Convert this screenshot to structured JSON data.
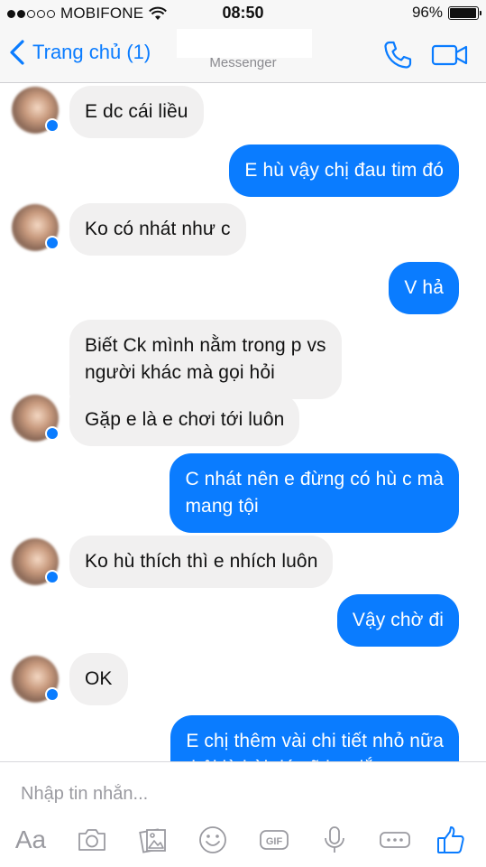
{
  "status_bar": {
    "carrier": "MOBIFONE",
    "time": "08:50",
    "battery": "96%",
    "battery_level": 0.96
  },
  "nav": {
    "back_label": "Trang chủ (1)",
    "subtitle": "Messenger"
  },
  "messages": [
    {
      "side": "in",
      "text": "E dc cái liều"
    },
    {
      "side": "out",
      "text": "E hù vậy chị đau tim đó"
    },
    {
      "side": "in",
      "text": "Ko có nhát như c"
    },
    {
      "side": "out",
      "text": "V hả"
    },
    {
      "side": "in",
      "text": "Biết Ck mình nằm trong p vs\nngười khác mà gọi hỏi"
    },
    {
      "side": "in",
      "text": "Gặp e là e chơi tới luôn"
    },
    {
      "side": "out",
      "text": "C nhát nên e đừng có hù c mà\nmang tội"
    },
    {
      "side": "in",
      "text": "Ko hù thích thì e nhích luôn"
    },
    {
      "side": "out",
      "text": "Vậy chờ đi"
    },
    {
      "side": "in",
      "text": "OK"
    },
    {
      "side": "out",
      "text": "E chị thêm vài chi tiết nhỏ nữa\nthôi là bài đó sẽ hơt lắm"
    }
  ],
  "composer": {
    "placeholder": "Nhập tin nhắn...",
    "text_tool_label": "Aa",
    "tools": [
      "aa-icon",
      "camera-icon",
      "photo-gallery-icon",
      "emoji-icon",
      "gif-icon",
      "microphone-icon",
      "more-icon",
      "thumbs-up-icon"
    ]
  },
  "colors": {
    "accent": "#0a7cff",
    "incoming_bubble": "#f1f0f0",
    "outgoing_text": "#ffffff"
  }
}
